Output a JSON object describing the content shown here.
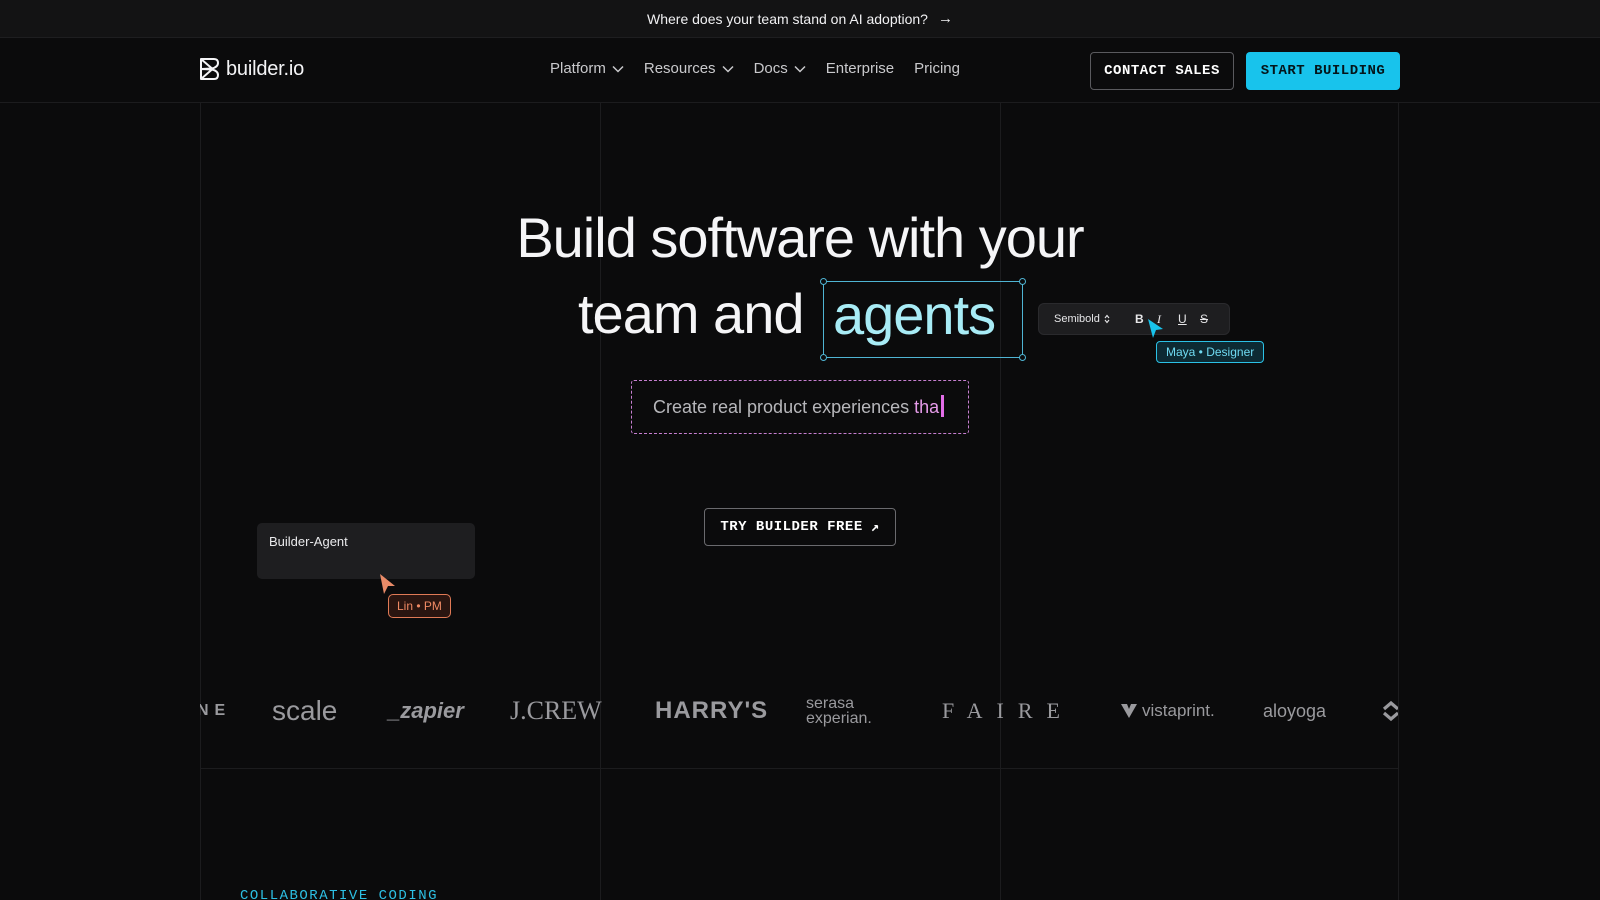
{
  "announcement": {
    "text": "Where does your team stand on AI adoption?",
    "arrow": "→"
  },
  "nav": {
    "logo_text": "builder.io",
    "menu": [
      {
        "label": "Platform",
        "has_dropdown": true
      },
      {
        "label": "Resources",
        "has_dropdown": true
      },
      {
        "label": "Docs",
        "has_dropdown": true
      },
      {
        "label": "Enterprise",
        "has_dropdown": false
      },
      {
        "label": "Pricing",
        "has_dropdown": false
      }
    ],
    "contact_label": "CONTACT SALES",
    "start_label": "START BUILDING"
  },
  "hero": {
    "line1": "Build software with your",
    "line2_prefix": "team and",
    "highlight_word": "agents",
    "subline_static": "Create real product experiences",
    "subline_typed": "tha",
    "cta_label": "TRY BUILDER FREE",
    "cta_icon": "↗"
  },
  "editor_toolbar": {
    "font_weight": "Semibold",
    "bold": "B",
    "italic": "I",
    "underline": "U",
    "strike": "S"
  },
  "collaborators": {
    "designer_tag": "Maya • Designer",
    "pm_tag": "Lin • PM",
    "agent_card_label": "Builder-Agent"
  },
  "customer_logos": [
    "NE",
    "scale",
    "_zapier",
    "J.CREW",
    "HARRY'S",
    "serasa experian.",
    "FAIRE",
    "vistaprint.",
    "aloyoga"
  ],
  "section": {
    "kicker": "COLLABORATIVE CODING"
  },
  "colors": {
    "accent": "#18c3ec",
    "background": "#0b0b0c",
    "selection": "#4fb4d3",
    "typing": "#e36de8",
    "pm_cursor": "#e07a56"
  }
}
